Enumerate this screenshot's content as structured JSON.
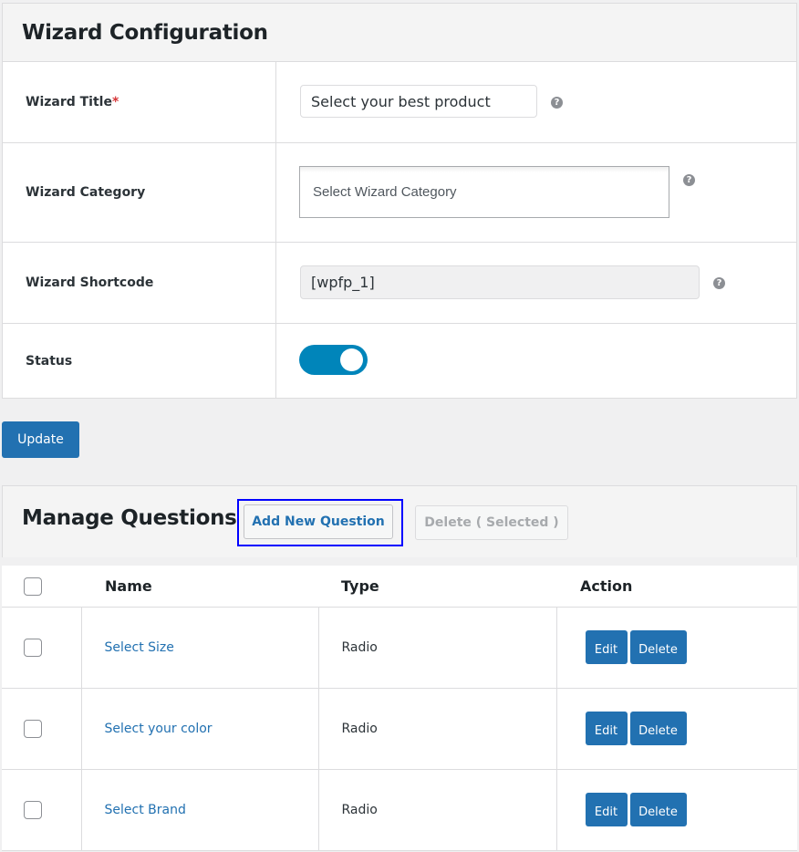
{
  "config": {
    "title": "Wizard Configuration",
    "fields": {
      "wizard_title": {
        "label": "Wizard Title",
        "required_mark": "*",
        "value": "Select your best product"
      },
      "wizard_category": {
        "label": "Wizard Category",
        "placeholder": "Select Wizard Category"
      },
      "wizard_shortcode": {
        "label": "Wizard Shortcode",
        "value": "[wpfp_1]"
      },
      "status": {
        "label": "Status",
        "enabled": true
      }
    },
    "help_icon": "?",
    "update_label": "Update"
  },
  "questions": {
    "title": "Manage Questions",
    "add_label": "Add New Question",
    "delete_selected_label": "Delete ( Selected )",
    "columns": {
      "name": "Name",
      "type": "Type",
      "action": "Action"
    },
    "edit_label": "Edit",
    "delete_label": "Delete",
    "rows": [
      {
        "name": "Select Size",
        "type": "Radio"
      },
      {
        "name": "Select your color",
        "type": "Radio"
      },
      {
        "name": "Select Brand",
        "type": "Radio"
      }
    ]
  },
  "colors": {
    "primary": "#2271b1",
    "toggle_on": "#0085ba",
    "required": "#d63638",
    "focus_ring": "#0000ff"
  }
}
